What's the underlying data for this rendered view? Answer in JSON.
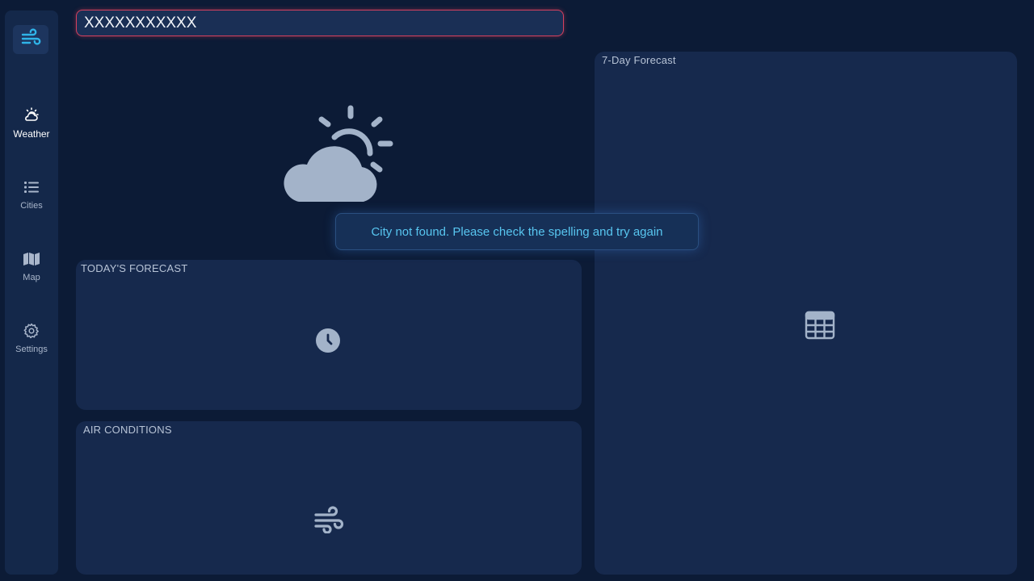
{
  "search": {
    "value": "XXXXXXXXXXX",
    "placeholder": ""
  },
  "sidebar": {
    "logo_icon": "wind-icon",
    "items": [
      {
        "label": "Weather",
        "icon": "cloud-sun-icon",
        "active": true
      },
      {
        "label": "Cities",
        "icon": "list-icon",
        "active": false
      },
      {
        "label": "Map",
        "icon": "map-icon",
        "active": false
      },
      {
        "label": "Settings",
        "icon": "gear-icon",
        "active": false
      }
    ]
  },
  "hero": {
    "icon": "partly-cloudy-icon"
  },
  "toast": {
    "message": "City not found. Please check the spelling and try again"
  },
  "panels": {
    "today": {
      "title": "TODAY'S FORECAST",
      "icon": "clock-icon"
    },
    "air": {
      "title": "AIR CONDITIONS",
      "icon": "wind-icon"
    },
    "week": {
      "title": "7-Day Forecast",
      "icon": "table-icon"
    }
  },
  "colors": {
    "background": "#0c1b36",
    "panel": "#16294d",
    "accent": "#2fb4e8",
    "error_border": "#d5405e",
    "toast_text": "#58c6f0"
  }
}
